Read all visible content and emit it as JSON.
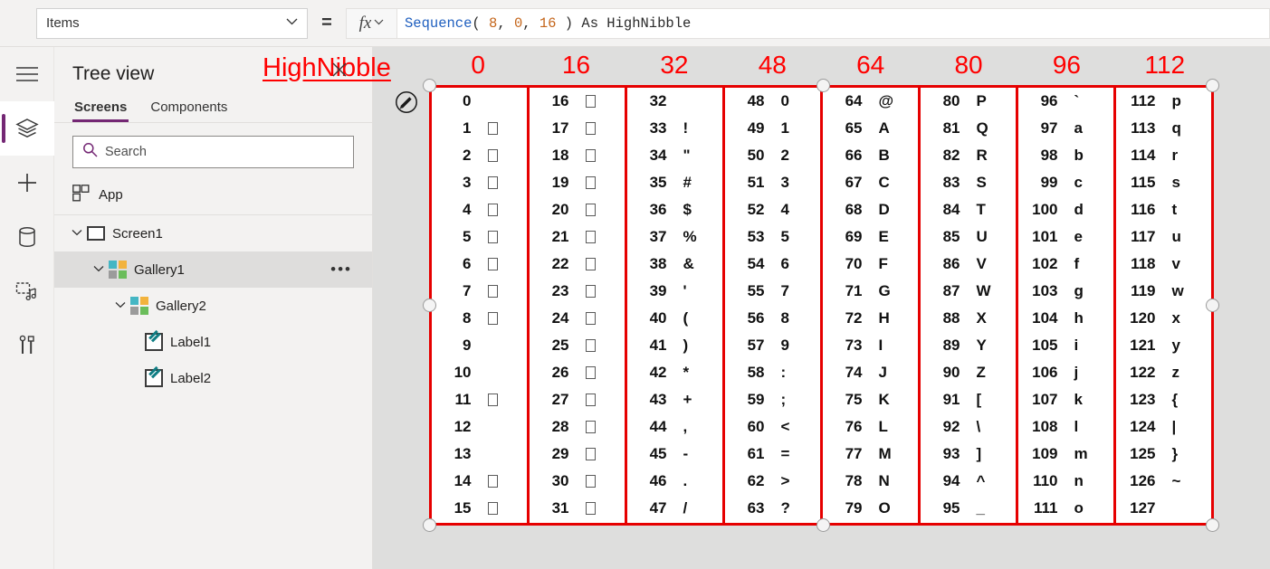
{
  "topbar": {
    "property_selected": "Items",
    "property_placeholder": "Items",
    "equals": "=",
    "fx_label": "fx",
    "chevron": "∨",
    "formula_tokens": [
      {
        "text": "Sequence",
        "kind": "fn"
      },
      {
        "text": "( ",
        "kind": "punc"
      },
      {
        "text": "8",
        "kind": "num"
      },
      {
        "text": ", ",
        "kind": "punc"
      },
      {
        "text": "0",
        "kind": "num"
      },
      {
        "text": ", ",
        "kind": "punc"
      },
      {
        "text": "16",
        "kind": "num"
      },
      {
        "text": " ) ",
        "kind": "punc"
      },
      {
        "text": "As",
        "kind": "kw"
      },
      {
        "text": " HighNibble",
        "kind": "id"
      }
    ],
    "formula_text": "Sequence( 8, 0, 16 ) As HighNibble"
  },
  "rail": {
    "items": [
      {
        "name": "hamburger-menu-icon",
        "active": false
      },
      {
        "name": "tree-view-icon",
        "active": true
      },
      {
        "name": "insert-icon",
        "active": false
      },
      {
        "name": "data-icon",
        "active": false
      },
      {
        "name": "media-icon",
        "active": false
      },
      {
        "name": "advanced-tools-icon",
        "active": false
      }
    ]
  },
  "tree": {
    "title": "Tree view",
    "tabs": [
      {
        "label": "Screens",
        "selected": true
      },
      {
        "label": "Components",
        "selected": false
      }
    ],
    "search_placeholder": "Search",
    "search_value": "",
    "app_label": "App",
    "nodes": [
      {
        "label": "Screen1",
        "indent": 1,
        "icon": "screen-icon",
        "chevron": "⌄",
        "selected": false,
        "menu": false
      },
      {
        "label": "Gallery1",
        "indent": 2,
        "icon": "gallery-icon",
        "chevron": "⌄",
        "selected": true,
        "menu": true
      },
      {
        "label": "Gallery2",
        "indent": 3,
        "icon": "gallery-icon",
        "chevron": "⌄",
        "selected": false,
        "menu": false
      },
      {
        "label": "Label1",
        "indent": 4,
        "icon": "label-icon",
        "chevron": "",
        "selected": false,
        "menu": false
      },
      {
        "label": "Label2",
        "indent": 4,
        "icon": "label-icon",
        "chevron": "",
        "selected": false,
        "menu": false
      }
    ],
    "overflow_menu": "•••"
  },
  "canvas": {
    "annotation_label": "HighNibble",
    "annotation_color": "#ff0000",
    "selection_color": "#e60000",
    "column_headers": [
      "0",
      "16",
      "32",
      "48",
      "64",
      "80",
      "96",
      "112"
    ],
    "columns": [
      {
        "header": "0",
        "rows": [
          {
            "num": "0",
            "chr": ""
          },
          {
            "num": "1",
            "chr": "□"
          },
          {
            "num": "2",
            "chr": "□"
          },
          {
            "num": "3",
            "chr": "□"
          },
          {
            "num": "4",
            "chr": "□"
          },
          {
            "num": "5",
            "chr": "□"
          },
          {
            "num": "6",
            "chr": "□"
          },
          {
            "num": "7",
            "chr": "□"
          },
          {
            "num": "8",
            "chr": "□"
          },
          {
            "num": "9",
            "chr": ""
          },
          {
            "num": "10",
            "chr": ""
          },
          {
            "num": "11",
            "chr": "□"
          },
          {
            "num": "12",
            "chr": ""
          },
          {
            "num": "13",
            "chr": ""
          },
          {
            "num": "14",
            "chr": "□"
          },
          {
            "num": "15",
            "chr": "□"
          }
        ]
      },
      {
        "header": "16",
        "rows": [
          {
            "num": "16",
            "chr": "□"
          },
          {
            "num": "17",
            "chr": "□"
          },
          {
            "num": "18",
            "chr": "□"
          },
          {
            "num": "19",
            "chr": "□"
          },
          {
            "num": "20",
            "chr": "□"
          },
          {
            "num": "21",
            "chr": "□"
          },
          {
            "num": "22",
            "chr": "□"
          },
          {
            "num": "23",
            "chr": "□"
          },
          {
            "num": "24",
            "chr": "□"
          },
          {
            "num": "25",
            "chr": "□"
          },
          {
            "num": "26",
            "chr": "□"
          },
          {
            "num": "27",
            "chr": "□"
          },
          {
            "num": "28",
            "chr": "□"
          },
          {
            "num": "29",
            "chr": "□"
          },
          {
            "num": "30",
            "chr": "□"
          },
          {
            "num": "31",
            "chr": "□"
          }
        ]
      },
      {
        "header": "32",
        "rows": [
          {
            "num": "32",
            "chr": ""
          },
          {
            "num": "33",
            "chr": "!"
          },
          {
            "num": "34",
            "chr": "\""
          },
          {
            "num": "35",
            "chr": "#"
          },
          {
            "num": "36",
            "chr": "$"
          },
          {
            "num": "37",
            "chr": "%"
          },
          {
            "num": "38",
            "chr": "&"
          },
          {
            "num": "39",
            "chr": "'"
          },
          {
            "num": "40",
            "chr": "("
          },
          {
            "num": "41",
            "chr": ")"
          },
          {
            "num": "42",
            "chr": "*"
          },
          {
            "num": "43",
            "chr": "+"
          },
          {
            "num": "44",
            "chr": ","
          },
          {
            "num": "45",
            "chr": "-"
          },
          {
            "num": "46",
            "chr": "."
          },
          {
            "num": "47",
            "chr": "/"
          }
        ]
      },
      {
        "header": "48",
        "rows": [
          {
            "num": "48",
            "chr": "0"
          },
          {
            "num": "49",
            "chr": "1"
          },
          {
            "num": "50",
            "chr": "2"
          },
          {
            "num": "51",
            "chr": "3"
          },
          {
            "num": "52",
            "chr": "4"
          },
          {
            "num": "53",
            "chr": "5"
          },
          {
            "num": "54",
            "chr": "6"
          },
          {
            "num": "55",
            "chr": "7"
          },
          {
            "num": "56",
            "chr": "8"
          },
          {
            "num": "57",
            "chr": "9"
          },
          {
            "num": "58",
            "chr": ":"
          },
          {
            "num": "59",
            "chr": ";"
          },
          {
            "num": "60",
            "chr": "<"
          },
          {
            "num": "61",
            "chr": "="
          },
          {
            "num": "62",
            "chr": ">"
          },
          {
            "num": "63",
            "chr": "?"
          }
        ]
      },
      {
        "header": "64",
        "rows": [
          {
            "num": "64",
            "chr": "@"
          },
          {
            "num": "65",
            "chr": "A"
          },
          {
            "num": "66",
            "chr": "B"
          },
          {
            "num": "67",
            "chr": "C"
          },
          {
            "num": "68",
            "chr": "D"
          },
          {
            "num": "69",
            "chr": "E"
          },
          {
            "num": "70",
            "chr": "F"
          },
          {
            "num": "71",
            "chr": "G"
          },
          {
            "num": "72",
            "chr": "H"
          },
          {
            "num": "73",
            "chr": "I"
          },
          {
            "num": "74",
            "chr": "J"
          },
          {
            "num": "75",
            "chr": "K"
          },
          {
            "num": "76",
            "chr": "L"
          },
          {
            "num": "77",
            "chr": "M"
          },
          {
            "num": "78",
            "chr": "N"
          },
          {
            "num": "79",
            "chr": "O"
          }
        ]
      },
      {
        "header": "80",
        "rows": [
          {
            "num": "80",
            "chr": "P"
          },
          {
            "num": "81",
            "chr": "Q"
          },
          {
            "num": "82",
            "chr": "R"
          },
          {
            "num": "83",
            "chr": "S"
          },
          {
            "num": "84",
            "chr": "T"
          },
          {
            "num": "85",
            "chr": "U"
          },
          {
            "num": "86",
            "chr": "V"
          },
          {
            "num": "87",
            "chr": "W"
          },
          {
            "num": "88",
            "chr": "X"
          },
          {
            "num": "89",
            "chr": "Y"
          },
          {
            "num": "90",
            "chr": "Z"
          },
          {
            "num": "91",
            "chr": "["
          },
          {
            "num": "92",
            "chr": "\\"
          },
          {
            "num": "93",
            "chr": "]"
          },
          {
            "num": "94",
            "chr": "^"
          },
          {
            "num": "95",
            "chr": "_"
          }
        ]
      },
      {
        "header": "96",
        "rows": [
          {
            "num": "96",
            "chr": "`"
          },
          {
            "num": "97",
            "chr": "a"
          },
          {
            "num": "98",
            "chr": "b"
          },
          {
            "num": "99",
            "chr": "c"
          },
          {
            "num": "100",
            "chr": "d"
          },
          {
            "num": "101",
            "chr": "e"
          },
          {
            "num": "102",
            "chr": "f"
          },
          {
            "num": "103",
            "chr": "g"
          },
          {
            "num": "104",
            "chr": "h"
          },
          {
            "num": "105",
            "chr": "i"
          },
          {
            "num": "106",
            "chr": "j"
          },
          {
            "num": "107",
            "chr": "k"
          },
          {
            "num": "108",
            "chr": "l"
          },
          {
            "num": "109",
            "chr": "m"
          },
          {
            "num": "110",
            "chr": "n"
          },
          {
            "num": "111",
            "chr": "o"
          }
        ]
      },
      {
        "header": "112",
        "rows": [
          {
            "num": "112",
            "chr": "p"
          },
          {
            "num": "113",
            "chr": "q"
          },
          {
            "num": "114",
            "chr": "r"
          },
          {
            "num": "115",
            "chr": "s"
          },
          {
            "num": "116",
            "chr": "t"
          },
          {
            "num": "117",
            "chr": "u"
          },
          {
            "num": "118",
            "chr": "v"
          },
          {
            "num": "119",
            "chr": "w"
          },
          {
            "num": "120",
            "chr": "x"
          },
          {
            "num": "121",
            "chr": "y"
          },
          {
            "num": "122",
            "chr": "z"
          },
          {
            "num": "123",
            "chr": "{"
          },
          {
            "num": "124",
            "chr": "|"
          },
          {
            "num": "125",
            "chr": "}"
          },
          {
            "num": "126",
            "chr": "~"
          },
          {
            "num": "127",
            "chr": ""
          }
        ]
      }
    ]
  }
}
